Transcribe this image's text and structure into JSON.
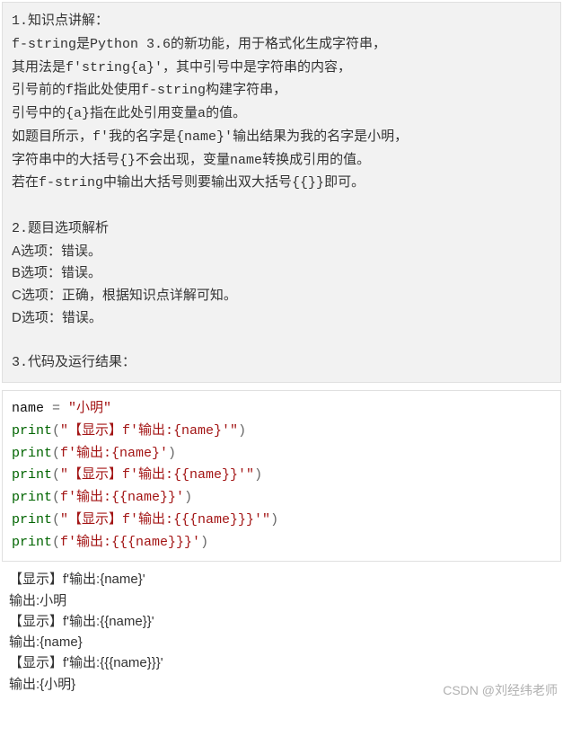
{
  "explain": {
    "line1": "1.知识点讲解：",
    "line2a": "f-string",
    "line2b": "是",
    "line2c": "Python 3.6",
    "line2d": "的新功能，用于格式化生成字符串，",
    "line3a": "其用法是",
    "line3b": "f'string{a}'",
    "line3c": "，其中引号中是字符串的内容，",
    "line4a": "引号前的",
    "line4b": "f",
    "line4c": "指此处使用",
    "line4d": "f-string",
    "line4e": "构建字符串，",
    "line5a": "引号中的",
    "line5b": "{a}",
    "line5c": "指在此处引用变量",
    "line5d": "a",
    "line5e": "的值。",
    "line6a": "如题目所示，",
    "line6b": "f'",
    "line6c": "我的名字是",
    "line6d": "{name}'",
    "line6e": "输出结果为我的名字是小明，",
    "line7a": "字符串中的大括号",
    "line7b": "{}",
    "line7c": "不会出现，变量",
    "line7d": "name",
    "line7e": "转换成引用的值。",
    "line8a": "若在",
    "line8b": "f-string",
    "line8c": "中输出大括号则要输出双大括号",
    "line8d": "{{}}",
    "line8e": "即可。",
    "blank1": " ",
    "sec2": "2.题目选项解析",
    "optA": "A选项：错误。",
    "optB": "B选项：错误。",
    "optC": "C选项：正确，根据知识点详解可知。",
    "optD": "D选项：错误。",
    "blank2": " ",
    "sec3": "3.代码及运行结果："
  },
  "code": {
    "l1_name": "name ",
    "l1_eq": "= ",
    "l1_str": "\"小明\"",
    "print": "print",
    "lp": "(",
    "rp": ")",
    "l2_str": "\"【显示】f'输出:{name}'\"",
    "l3_str": "f'输出:{name}'",
    "l4_str": "\"【显示】f'输出:{{name}}'\"",
    "l5_str": "f'输出:{{name}}'",
    "l6_str": "\"【显示】f'输出:{{{name}}}'\"",
    "l7_str": "f'输出:{{{name}}}'"
  },
  "out": {
    "l1": "【显示】f'输出:{name}'",
    "l2": "输出:小明",
    "l3": "【显示】f'输出:{{name}}'",
    "l4": "输出:{name}",
    "l5": "【显示】f'输出:{{{name}}}'",
    "l6": "输出:{小明}"
  },
  "watermark": "CSDN @刘经纬老师"
}
